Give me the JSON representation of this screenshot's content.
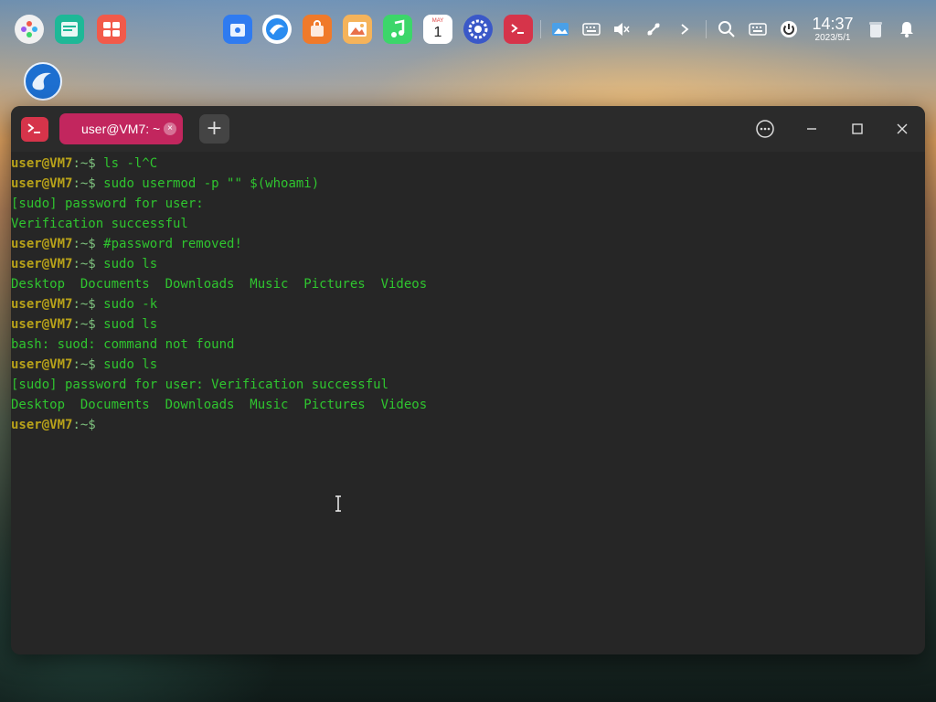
{
  "dock": {
    "apps": [
      {
        "name": "launcher",
        "color": "#f1f1f1"
      },
      {
        "name": "file-manager",
        "color": "#1eb897"
      },
      {
        "name": "app-store",
        "color": "#f25a4a"
      },
      {
        "name": "app-store-blue",
        "color": "#2f7bf0"
      },
      {
        "name": "browser",
        "color": "#2a8cf0"
      },
      {
        "name": "store",
        "color": "#f07a2a"
      },
      {
        "name": "image-viewer",
        "color": "#e87a50"
      },
      {
        "name": "music",
        "color": "#3cd66a"
      },
      {
        "name": "calendar",
        "color": "#ffffff"
      },
      {
        "name": "settings",
        "color": "#3a58c8"
      },
      {
        "name": "terminal",
        "color": "#d6344a"
      }
    ],
    "calendar": {
      "month": "MAY",
      "day": "1"
    },
    "clock": {
      "time": "14:37",
      "date": "2023/5/1"
    }
  },
  "window": {
    "tab_label": "user@VM7: ~",
    "tab_close": "×",
    "new_tab": "+"
  },
  "terminal": {
    "lines": [
      {
        "type": "prompt",
        "user": "user@VM7",
        "rest": ":~$ ",
        "cmd": "ls -l^C"
      },
      {
        "type": "prompt",
        "user": "user@VM7",
        "rest": ":~$ ",
        "cmd": "sudo usermod -p \"\" $(whoami)"
      },
      {
        "type": "out",
        "text": "[sudo] password for user:"
      },
      {
        "type": "out",
        "text": "Verification successful"
      },
      {
        "type": "prompt",
        "user": "user@VM7",
        "rest": ":~$ ",
        "cmd": "#password removed!"
      },
      {
        "type": "prompt",
        "user": "user@VM7",
        "rest": ":~$ ",
        "cmd": "sudo ls"
      },
      {
        "type": "out",
        "text": "Desktop  Documents  Downloads  Music  Pictures  Videos"
      },
      {
        "type": "prompt",
        "user": "user@VM7",
        "rest": ":~$ ",
        "cmd": "sudo -k"
      },
      {
        "type": "prompt",
        "user": "user@VM7",
        "rest": ":~$ ",
        "cmd": "suod ls"
      },
      {
        "type": "out",
        "text": "bash: suod: command not found"
      },
      {
        "type": "prompt",
        "user": "user@VM7",
        "rest": ":~$ ",
        "cmd": "sudo ls"
      },
      {
        "type": "out",
        "text": "[sudo] password for user: Verification successful"
      },
      {
        "type": "out",
        "text": "Desktop  Documents  Downloads  Music  Pictures  Videos"
      },
      {
        "type": "prompt",
        "user": "user@VM7",
        "rest": ":~$ ",
        "cmd": ""
      }
    ]
  }
}
